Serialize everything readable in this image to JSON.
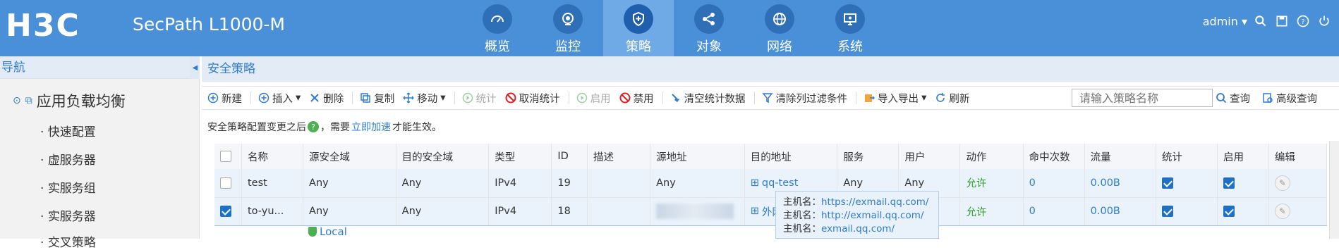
{
  "header": {
    "logo": "H3C",
    "product": "SecPath L1000-M",
    "nav": [
      "概览",
      "监控",
      "策略",
      "对象",
      "网络",
      "系统"
    ],
    "active_nav": "策略",
    "user": "admin"
  },
  "sidebar": {
    "title": "导航",
    "group": "应用负载均衡",
    "items": [
      "快速配置",
      "虚服务器",
      "实服务组",
      "实服务器",
      "交叉策略"
    ]
  },
  "main": {
    "title": "安全策略",
    "toolbar": [
      {
        "label": "新建",
        "icon": "plus-circle-icon",
        "enabled": true
      },
      {
        "label": "插入",
        "icon": "plus-circle-icon",
        "enabled": true,
        "dropdown": true
      },
      {
        "label": "删除",
        "icon": "x-icon",
        "enabled": true
      },
      {
        "label": "复制",
        "icon": "copy-icon",
        "enabled": true
      },
      {
        "label": "移动",
        "icon": "move-icon",
        "enabled": true,
        "dropdown": true
      },
      {
        "label": "统计",
        "icon": "play-icon",
        "enabled": false
      },
      {
        "label": "取消统计",
        "icon": "ban-icon",
        "enabled": true
      },
      {
        "label": "启用",
        "icon": "play-icon",
        "enabled": false
      },
      {
        "label": "禁用",
        "icon": "ban-icon",
        "enabled": true
      },
      {
        "label": "清空统计数据",
        "icon": "broom-icon",
        "enabled": true
      },
      {
        "label": "清除列过滤条件",
        "icon": "filter-icon",
        "enabled": true
      },
      {
        "label": "导入导出",
        "icon": "import-export-icon",
        "enabled": true,
        "dropdown": true
      },
      {
        "label": "刷新",
        "icon": "refresh-icon",
        "enabled": true
      }
    ],
    "search_placeholder": "请输入策略名称",
    "query_label": "查询",
    "advanced_query_label": "高级查询",
    "notice_prefix": "安全策略配置变更之后",
    "notice_mid": "，需要",
    "notice_link": "立即加速",
    "notice_suffix": "才能生效。"
  },
  "table": {
    "columns": [
      "名称",
      "源安全域",
      "目的安全域",
      "类型",
      "ID",
      "描述",
      "源地址",
      "目的地址",
      "服务",
      "用户",
      "动作",
      "命中次数",
      "流量",
      "统计",
      "启用",
      "编辑"
    ],
    "rows": [
      {
        "checked": false,
        "name": "test",
        "src_zone": "Any",
        "dst_zone": "Any",
        "type": "IPv4",
        "id": "19",
        "desc": "",
        "src_addr": "Any",
        "dst_addr": "qq-test",
        "service": "Any",
        "user": "Any",
        "action": "允许",
        "hits": "0",
        "traffic": "0.00B",
        "stat": true,
        "enable": true
      },
      {
        "checked": true,
        "name": "to-yu...",
        "src_zone": "Any",
        "dst_zone": "Any",
        "type": "IPv4",
        "id": "18",
        "desc": "",
        "src_addr": "",
        "dst_addr": "外网纟",
        "service": "",
        "user": "",
        "action": "允许",
        "hits": "0",
        "traffic": "0.00B",
        "stat": true,
        "enable": true
      }
    ],
    "partial_row_zone": "Local"
  },
  "tooltip": {
    "lines": [
      {
        "key": "主机名：",
        "value": "https://exmail.qq.com/"
      },
      {
        "key": "主机名：",
        "value": "http://exmail.qq.com/"
      },
      {
        "key": "主机名：",
        "value": "exmail.qq.com/"
      }
    ]
  },
  "colors": {
    "header": "#4a90d9",
    "accent": "#2f7bd0",
    "allow": "#2b9b2b"
  }
}
